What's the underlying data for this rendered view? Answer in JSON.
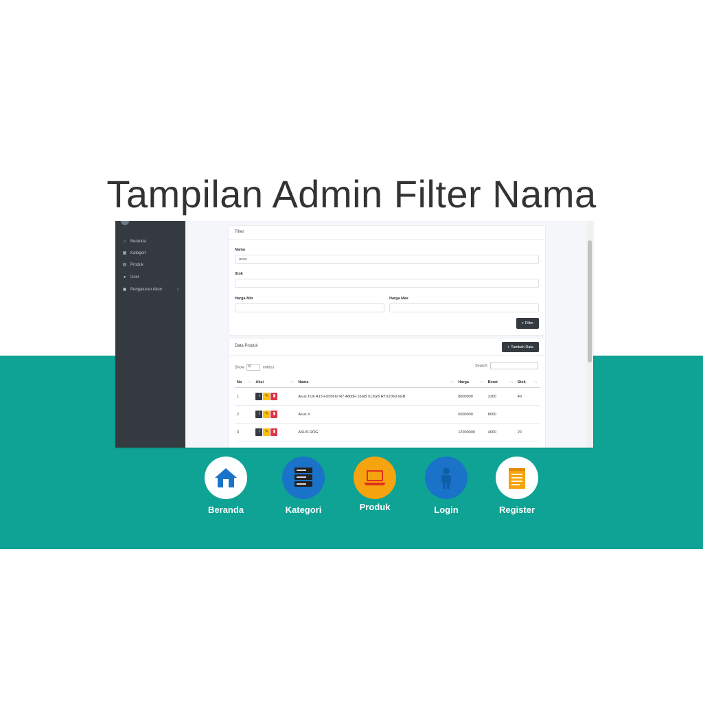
{
  "slide": {
    "title": "Tampilan Admin Filter Nama"
  },
  "colors": {
    "teal": "#0ea394",
    "sidebar": "#343a40",
    "login_blue": "#1a73c9",
    "produk_orange": "#f5a30f"
  },
  "sidebar": {
    "items": [
      {
        "label": "Beranda",
        "icon": "home-icon"
      },
      {
        "label": "Kategori",
        "icon": "grid-icon"
      },
      {
        "label": "Produk",
        "icon": "box-icon"
      },
      {
        "label": "User",
        "icon": "user-icon"
      },
      {
        "label": "Pengaturan Akun",
        "icon": "id-card-icon"
      }
    ]
  },
  "filter": {
    "header": "Filter",
    "nama_label": "Nama",
    "nama_value": "asus",
    "stok_label": "Stok",
    "stok_value": "",
    "harga_min_label": "Harga Min",
    "harga_max_label": "Harga Max",
    "button": "Filter"
  },
  "data_produk": {
    "header": "Data Produk",
    "add_button": "Tambah Data",
    "show_label": "Show",
    "show_value": "10",
    "entries_label": "entries",
    "search_label": "Search:",
    "columns": [
      "No",
      "Aksi",
      "Nama",
      "Harga",
      "Berat",
      "Stok"
    ],
    "rows": [
      {
        "no": "1",
        "nama": "Asus TUF A15 FX506IV R7 4800H 16GB 512GB RTX2060 6GB",
        "harga": "8000000",
        "berat": "2300",
        "stok": "40"
      },
      {
        "no": "2",
        "nama": "Asus X",
        "harga": "6000000",
        "berat": "8000",
        "stok": ""
      },
      {
        "no": "3",
        "nama": "ASUS ROG",
        "harga": "12000000",
        "berat": "4000",
        "stok": "20"
      }
    ]
  },
  "nav": [
    {
      "label": "Beranda",
      "icon": "home-icon"
    },
    {
      "label": "Kategori",
      "icon": "server-icon"
    },
    {
      "label": "Produk",
      "icon": "laptop-icon"
    },
    {
      "label": "Login",
      "icon": "person-icon"
    },
    {
      "label": "Register",
      "icon": "notepad-icon"
    }
  ]
}
